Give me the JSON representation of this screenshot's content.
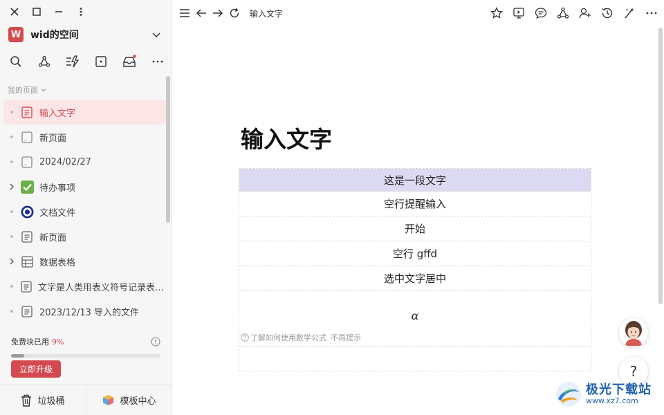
{
  "window": {
    "controls": [
      "close-icon",
      "maximize-icon",
      "minimize-icon",
      "more-vertical-icon"
    ]
  },
  "workspace": {
    "avatar_letter": "W",
    "name": "wid的空间",
    "accent": "#d24a4f"
  },
  "sidebar": {
    "section_label": "我的页面",
    "items": [
      {
        "label": "输入文字",
        "icon": "doc-icon",
        "active": true
      },
      {
        "label": "新页面",
        "icon": "blank-page-icon"
      },
      {
        "label": "2024/02/27",
        "icon": "blank-page-icon"
      },
      {
        "label": "待办事项",
        "icon": "check-box-icon",
        "expandable": true
      },
      {
        "label": "文档文件",
        "icon": "target-icon"
      },
      {
        "label": "新页面",
        "icon": "doc-icon"
      },
      {
        "label": "数据表格",
        "icon": "table-icon",
        "expandable": true
      },
      {
        "label": "文字是人类用表义符号记录表达信息以传之久远的方式和工具",
        "icon": "doc-icon"
      },
      {
        "label": "2023/12/13 导入的文件",
        "icon": "doc-icon"
      }
    ],
    "quota_label": "免费块已用",
    "quota_percent": "9%",
    "quota_fraction": 0.09,
    "upgrade_label": "立即升级",
    "trash_label": "垃圾桶",
    "templates_label": "模板中心"
  },
  "topbar": {
    "breadcrumb": "输入文字"
  },
  "document": {
    "title": "输入文字",
    "rows": [
      "这是一段文字",
      "空行提醒输入",
      "开始",
      "空行 gffd",
      "选中文字居中"
    ],
    "formula": "α",
    "math_tip": "了解如何使用数学公式",
    "math_tip_dismiss": "不再提示"
  },
  "help": {
    "label": "?"
  },
  "watermark": {
    "text": "极光下载站",
    "url": "www.xz7.com"
  }
}
